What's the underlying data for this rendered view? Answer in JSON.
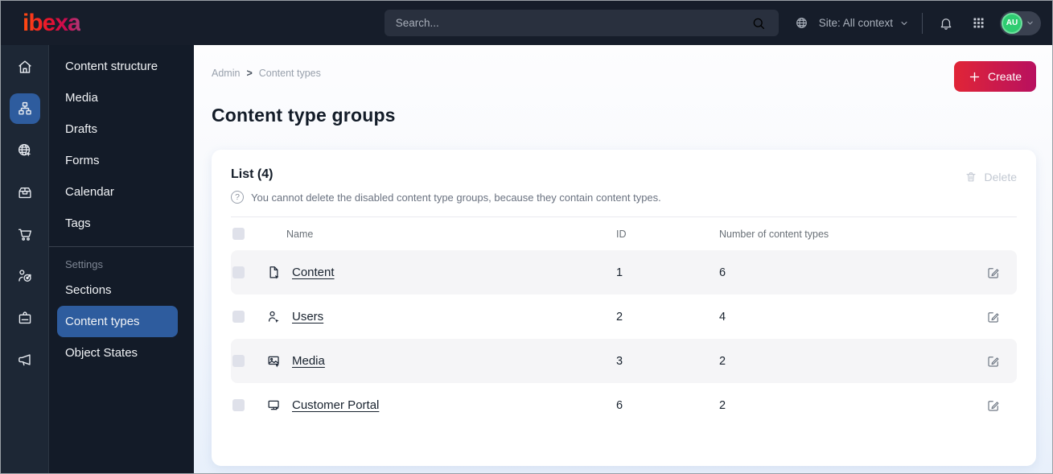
{
  "topbar": {
    "logo_text": "ibexa",
    "search_placeholder": "Search...",
    "site_context_label": "Site: All context",
    "avatar_initials": "AU",
    "icons": [
      "globe-icon",
      "chevron-down-icon",
      "bell-icon",
      "app-grid-icon"
    ]
  },
  "sidebar": {
    "rail_icons": [
      "home-icon",
      "content-tree-icon",
      "site-icon",
      "products-icon",
      "commerce-cart-icon",
      "personalization-icon",
      "admin-badge-icon",
      "marketing-megaphone-icon"
    ],
    "active_rail_icon": "content-tree-icon",
    "menu_items": [
      "Content structure",
      "Media",
      "Drafts",
      "Forms",
      "Calendar",
      "Tags"
    ],
    "settings_label": "Settings",
    "settings_items": [
      "Sections",
      "Content types",
      "Object States"
    ],
    "active_item": "Content types"
  },
  "main": {
    "breadcrumb": {
      "items": [
        "Admin",
        "Content types"
      ],
      "separator": ">"
    },
    "create_button_label": "Create",
    "page_title": "Content type groups",
    "list_panel": {
      "title": "List (4)",
      "info_text": "You cannot delete the disabled content type groups, because they contain content types.",
      "delete_button_label": "Delete",
      "table": {
        "columns": [
          "Name",
          "ID",
          "Number of content types"
        ],
        "rows": [
          {
            "name": "Content",
            "id": "1",
            "content_types_count": "6",
            "icon": "file-icon"
          },
          {
            "name": "Users",
            "id": "2",
            "content_types_count": "4",
            "icon": "user-icon"
          },
          {
            "name": "Media",
            "id": "3",
            "content_types_count": "2",
            "icon": "image-icon"
          },
          {
            "name": "Customer Portal",
            "id": "6",
            "content_types_count": "2",
            "icon": "monitor-icon"
          }
        ]
      }
    }
  },
  "colors": {
    "topbar_bg": "#161d2a",
    "sidebar_rail_bg": "#1d2735",
    "sidebar_menu_bg": "#131b28",
    "active_blue": "#2e5c9e",
    "create_gradient_start": "#e02537",
    "create_gradient_end": "#b8105f",
    "avatar_green": "#2ecc71",
    "row_alt_bg": "#f5f5f7",
    "text_dark": "#131c28"
  }
}
